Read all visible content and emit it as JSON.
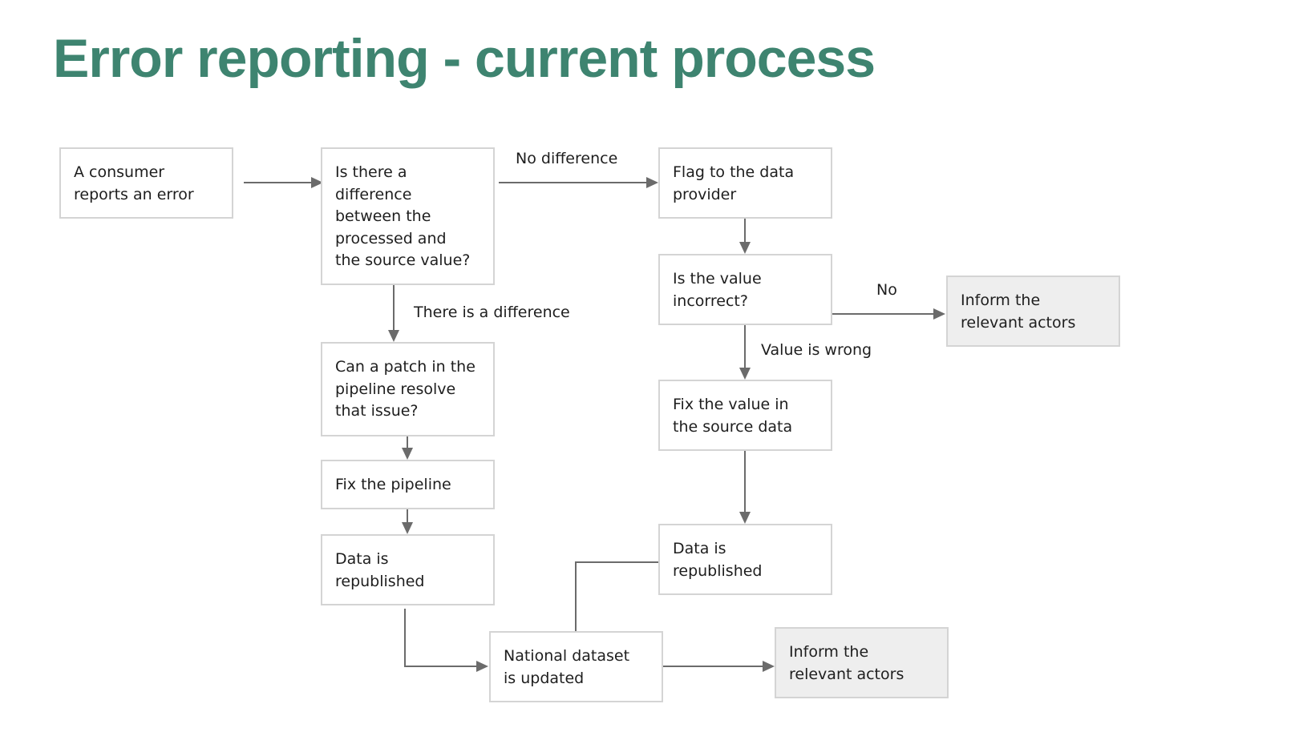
{
  "title": "Error reporting - current process",
  "colors": {
    "title": "#3e8470",
    "box_border": "#d4d4d4",
    "box_fill": "#ffffff",
    "terminal_fill": "#eeeeee",
    "connector": "#6b6b6b",
    "text": "#1e1e1e"
  },
  "nodes": {
    "consumer_reports": "A consumer\nreports an error",
    "is_difference": "Is there a\ndifference\nbetween the\nprocessed and\nthe source value?",
    "flag_provider": "Flag to the data\nprovider",
    "value_incorrect": "Is the value\nincorrect?",
    "inform_actors_1": "Inform the\nrelevant actors",
    "patch_pipeline": "Can a patch in the\npipeline resolve\nthat issue?",
    "fix_pipeline": "Fix the pipeline",
    "data_republished_left": "Data is\nrepublished",
    "fix_source_value": "Fix the value in\nthe source data",
    "data_republished_right": "Data is\nrepublished",
    "national_dataset": "National dataset\nis updated",
    "inform_actors_2": "Inform the\nrelevant actors"
  },
  "edge_labels": {
    "no_difference": "No difference",
    "there_is_difference": "There is a difference",
    "no": "No",
    "value_is_wrong": "Value is wrong"
  }
}
